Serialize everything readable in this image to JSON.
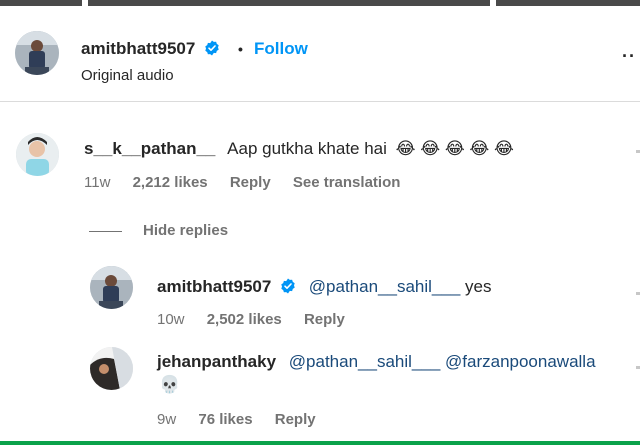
{
  "post": {
    "author": "amitbhatt9507",
    "separator": "•",
    "follow_label": "Follow",
    "audio": "Original audio",
    "more_label": "··"
  },
  "comments": [
    {
      "username": "s__k__pathan__",
      "text": "Aap gutkha khate hai",
      "emojis": "😂 😂 😂 😂 😂",
      "age": "11w",
      "likes": "2,212 likes",
      "reply_label": "Reply",
      "translate_label": "See translation"
    }
  ],
  "hide_replies_label": "Hide replies",
  "replies": [
    {
      "username": "amitbhatt9507",
      "mention": "@pathan__sahil___",
      "text": "yes",
      "age": "10w",
      "likes": "2,502 likes",
      "reply_label": "Reply"
    },
    {
      "username": "jehanpanthaky",
      "mention": "@pathan__sahil___",
      "mention2": "@farzanpoonawalla",
      "emoji": "💀",
      "age": "9w",
      "likes": "76 likes",
      "reply_label": "Reply"
    }
  ],
  "colors": {
    "link_blue": "#0095f6",
    "verified_blue": "#0095f6",
    "muted": "#737373",
    "text": "#262626",
    "bottom_bar": "#0aa24a"
  },
  "icons": [
    "verified-badge-icon",
    "more-options-icon",
    "skull-emoji",
    "laughing-emoji"
  ]
}
